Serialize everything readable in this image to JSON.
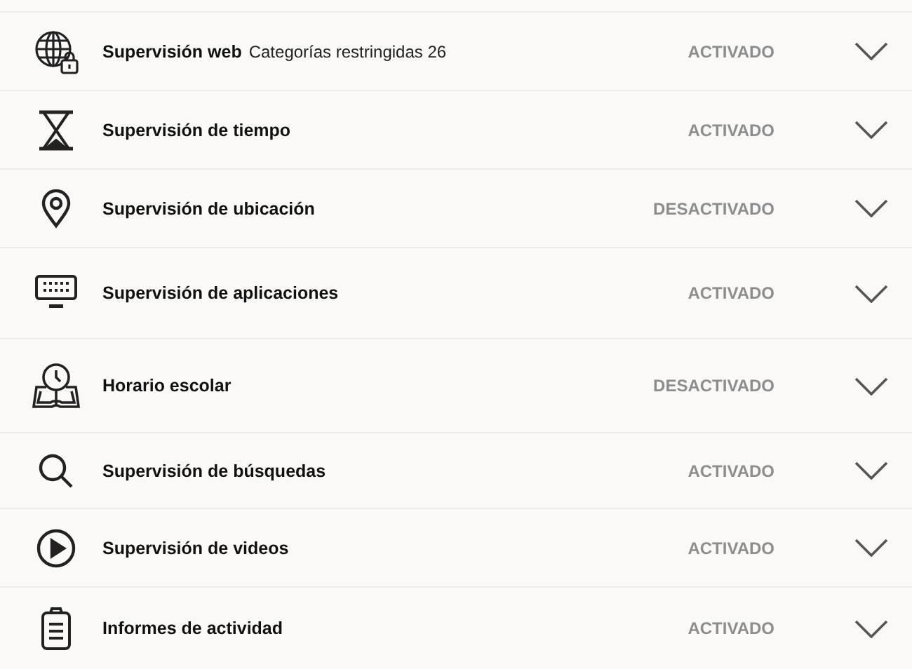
{
  "features": [
    {
      "kind": "globe",
      "title": "Supervisión web",
      "detail": "Categorías restringidas 26",
      "status": "ACTIVADO"
    },
    {
      "kind": "time",
      "title": "Supervisión de tiempo",
      "status": "ACTIVADO"
    },
    {
      "kind": "location",
      "title": "Supervisión de ubicación",
      "status": "DESACTIVADO"
    },
    {
      "kind": "apps",
      "title": "Supervisión de aplicaciones",
      "status": "ACTIVADO"
    },
    {
      "kind": "school",
      "title": "Horario escolar",
      "status": "DESACTIVADO"
    },
    {
      "kind": "search",
      "title": "Supervisión de búsquedas",
      "status": "ACTIVADO"
    },
    {
      "kind": "video",
      "title": "Supervisión de videos",
      "status": "ACTIVADO"
    },
    {
      "kind": "report",
      "title": "Informes de actividad",
      "status": "ACTIVADO"
    }
  ]
}
